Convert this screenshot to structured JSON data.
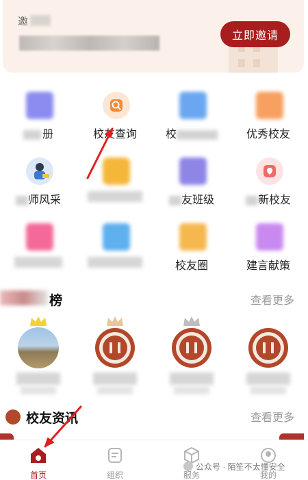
{
  "banner": {
    "text_prefix": "邀",
    "invite_button": "立即邀请"
  },
  "grid": {
    "items": [
      {
        "label": "册",
        "icon": "photo-album-icon",
        "color": "#8c8cf0"
      },
      {
        "label": "校友查询",
        "icon": "search-icon",
        "color": "#f3a25a"
      },
      {
        "label": "校",
        "icon": "directory-icon",
        "color": "#6aa7f0"
      },
      {
        "label": "优秀校友",
        "icon": "star-alumni-icon",
        "color": "#f7a060"
      },
      {
        "label": "师风采",
        "icon": "teacher-icon",
        "color": "#4a7fd6"
      },
      {
        "label": "",
        "icon": "lock-icon",
        "color": "#f5b73a"
      },
      {
        "label": "友班级",
        "icon": "class-icon",
        "color": "#8e85e6"
      },
      {
        "label": "新校友",
        "icon": "location-heart-icon",
        "color": "#f06a6a"
      },
      {
        "label": "",
        "icon": "gift-icon",
        "color": "#f36a9a"
      },
      {
        "label": "",
        "icon": "bag-icon",
        "color": "#5eb0ee"
      },
      {
        "label": "校友圈",
        "icon": "circle-icon",
        "color": "#f5b84e"
      },
      {
        "label": "建言献策",
        "icon": "suggestion-icon",
        "color": "#c98af0"
      }
    ]
  },
  "ranking": {
    "title": "榜",
    "more": "查看更多"
  },
  "news": {
    "title": "校友资讯",
    "more": "查看更多"
  },
  "tabbar": {
    "items": [
      {
        "label": "首页",
        "icon": "home-icon",
        "active": true
      },
      {
        "label": "组织",
        "icon": "organization-icon",
        "active": false
      },
      {
        "label": "服务",
        "icon": "service-icon",
        "active": false
      },
      {
        "label": "我的",
        "icon": "profile-icon",
        "active": false
      }
    ]
  },
  "watermark": "公众号 · 陌笙不太懂安全",
  "colors": {
    "accent": "#a81d1d",
    "muted": "#9a9a9a"
  }
}
